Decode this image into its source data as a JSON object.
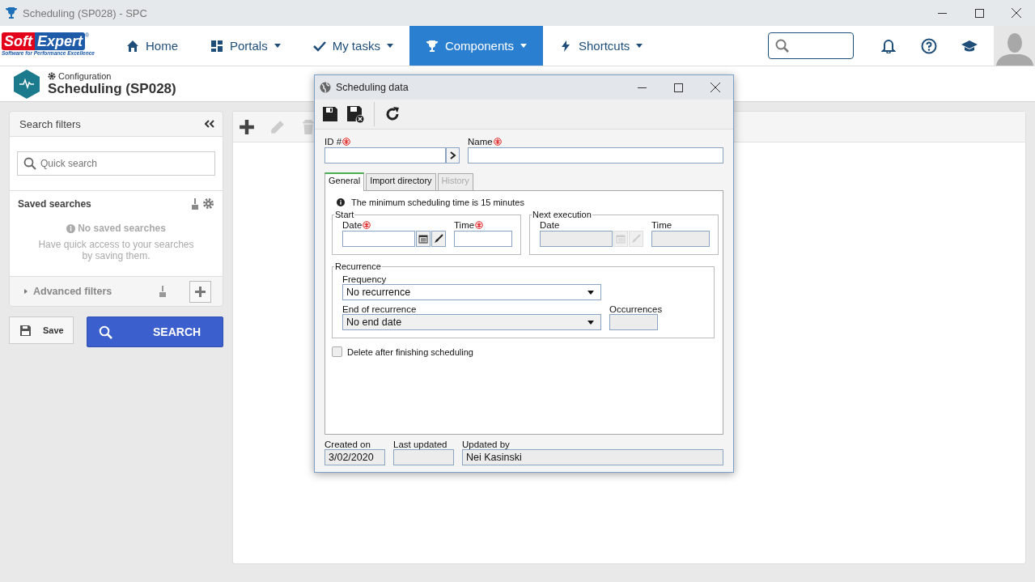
{
  "window": {
    "title": "Scheduling (SP028) - SPC"
  },
  "logo": {
    "first": "Soft",
    "second": "Expert",
    "registered": "®",
    "tagline": "Software for Performance Excellence"
  },
  "nav": [
    {
      "label": "Home",
      "selected": false,
      "has_menu": false
    },
    {
      "label": "Portals",
      "selected": false,
      "has_menu": true
    },
    {
      "label": "My tasks",
      "selected": false,
      "has_menu": true
    },
    {
      "label": "Components",
      "selected": true,
      "has_menu": true
    },
    {
      "label": "Shortcuts",
      "selected": false,
      "has_menu": true
    }
  ],
  "header": {
    "breadcrumb": "Configuration",
    "title": "Scheduling (SP028)"
  },
  "filters": {
    "title": "Search filters",
    "quick_search_placeholder": "Quick search",
    "saved_title": "Saved searches",
    "empty_title": "No saved searches",
    "empty_text": "Have quick access to your searches by saving them.",
    "advanced": "Advanced filters",
    "advanced_expanded": false
  },
  "actions": {
    "save": "Save",
    "search": "SEARCH"
  },
  "toolbar": [
    {
      "kind": "add",
      "disabled": false
    },
    {
      "kind": "edit",
      "disabled": true
    },
    {
      "kind": "delete",
      "disabled": true
    }
  ],
  "dialog": {
    "title": "Scheduling data",
    "id_field": {
      "label": "ID #",
      "required": true
    },
    "name_field": {
      "label": "Name",
      "required": true
    },
    "tabs": [
      {
        "label": "General",
        "selected": true,
        "disabled": false
      },
      {
        "label": "Import directory",
        "selected": false,
        "disabled": false
      },
      {
        "label": "History",
        "selected": false,
        "disabled": true
      }
    ],
    "info": "The minimum scheduling time is 15 minutes",
    "start": {
      "legend": "Start",
      "date_label": "Date",
      "date_required": true,
      "time_label": "Time",
      "time_required": true,
      "disabled": false
    },
    "next_execution": {
      "legend": "Next execution",
      "date_label": "Date",
      "date_required": false,
      "time_label": "Time",
      "time_required": false,
      "disabled": true
    },
    "recurrence": {
      "legend": "Recurrence",
      "frequency_label": "Frequency",
      "frequency": "No recurrence",
      "end_label": "End of recurrence",
      "end": "No end date",
      "occurrences_label": "Occurrences"
    },
    "delete_after": {
      "label": "Delete after finishing scheduling",
      "checked": false
    },
    "footer": [
      {
        "label": "Created on",
        "value": "3/02/2020"
      },
      {
        "label": "Last updated"
      },
      {
        "label": "Updated by",
        "value": "Nei Kasinski"
      }
    ]
  }
}
